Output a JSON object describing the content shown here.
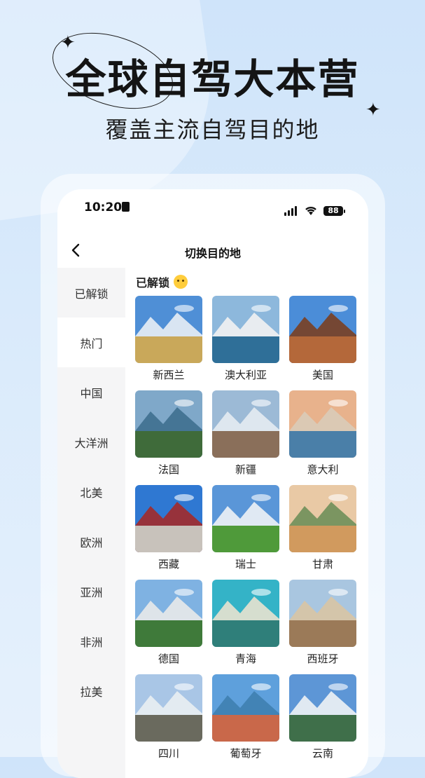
{
  "promo": {
    "title": "全球自驾大本营",
    "subtitle": "覆盖主流自驾目的地"
  },
  "status": {
    "time": "10:20",
    "battery": "88"
  },
  "nav": {
    "title": "切换目的地"
  },
  "sidebar": {
    "items": [
      {
        "label": "已解锁"
      },
      {
        "label": "热门"
      },
      {
        "label": "中国"
      },
      {
        "label": "大洋洲"
      },
      {
        "label": "北美"
      },
      {
        "label": "欧洲"
      },
      {
        "label": "亚洲"
      },
      {
        "label": "非洲"
      },
      {
        "label": "拉美"
      }
    ],
    "active_index": 1
  },
  "section": {
    "title": "已解锁"
  },
  "destinations": [
    {
      "name": "新西兰",
      "sky": "#4f8fd6",
      "ground": "#c9a85a",
      "accent": "#e8eef5"
    },
    {
      "name": "澳大利亚",
      "sky": "#8db8dc",
      "ground": "#2f6f98",
      "accent": "#f2f2f2"
    },
    {
      "name": "美国",
      "sky": "#4b8dd8",
      "ground": "#b4683a",
      "accent": "#7a3f22"
    },
    {
      "name": "法国",
      "sky": "#7fa8c9",
      "ground": "#3f6b3a",
      "accent": "#3f6f8f"
    },
    {
      "name": "新疆",
      "sky": "#9cbad6",
      "ground": "#8a6f5a",
      "accent": "#e6ecf2"
    },
    {
      "name": "意大利",
      "sky": "#e8b28c",
      "ground": "#4a7fa8",
      "accent": "#d9cbb8"
    },
    {
      "name": "西藏",
      "sky": "#2f78d2",
      "ground": "#c8c2bb",
      "accent": "#a32a2a"
    },
    {
      "name": "瑞士",
      "sky": "#5a96d8",
      "ground": "#4f9a3a",
      "accent": "#eef2f6"
    },
    {
      "name": "甘肃",
      "sky": "#e9c9a5",
      "ground": "#d19a5e",
      "accent": "#6f8f5a"
    },
    {
      "name": "德国",
      "sky": "#7fb2e2",
      "ground": "#3f7a3a",
      "accent": "#e9e9ea"
    },
    {
      "name": "青海",
      "sky": "#34b3c7",
      "ground": "#2f7f7a",
      "accent": "#e8e2cf"
    },
    {
      "name": "西班牙",
      "sky": "#a9c6e0",
      "ground": "#9b7a58",
      "accent": "#d8c4a4"
    },
    {
      "name": "四川",
      "sky": "#a9c6e6",
      "ground": "#6a6a5e",
      "accent": "#e9eef2"
    },
    {
      "name": "葡萄牙",
      "sky": "#5ea0dc",
      "ground": "#c9684a",
      "accent": "#3f7fb0"
    },
    {
      "name": "云南",
      "sky": "#5d96d6",
      "ground": "#3f6f4a",
      "accent": "#eef2f5"
    }
  ]
}
